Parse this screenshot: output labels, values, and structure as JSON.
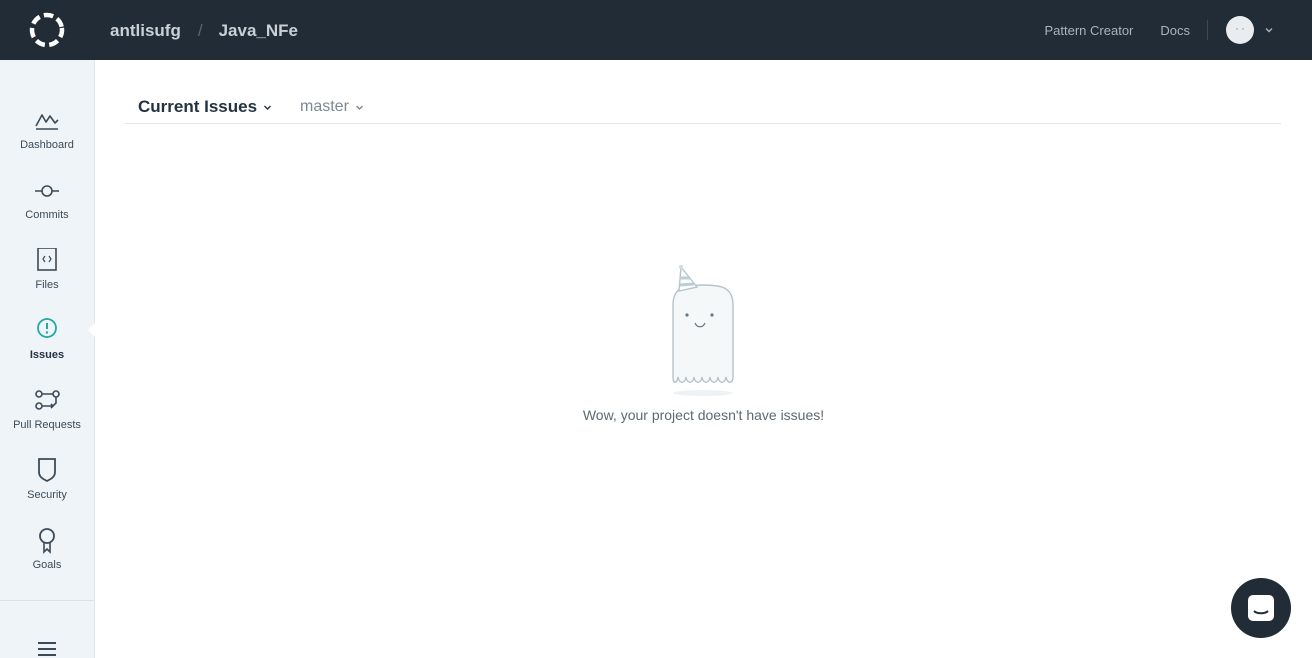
{
  "header": {
    "org": "antlisufg",
    "separator": "/",
    "repo": "Java_NFe",
    "links": {
      "pattern_creator": "Pattern Creator",
      "docs": "Docs"
    }
  },
  "sidebar": {
    "items": [
      {
        "label": "Dashboard",
        "icon": "dashboard-icon"
      },
      {
        "label": "Commits",
        "icon": "commit-icon"
      },
      {
        "label": "Files",
        "icon": "file-code-icon"
      },
      {
        "label": "Issues",
        "icon": "issue-icon",
        "active": true
      },
      {
        "label": "Pull Requests",
        "icon": "pull-request-icon"
      },
      {
        "label": "Security",
        "icon": "shield-icon"
      },
      {
        "label": "Goals",
        "icon": "goal-icon"
      }
    ]
  },
  "main": {
    "tab_label": "Current Issues",
    "branch": "master",
    "empty_message": "Wow, your project doesn't have issues!"
  },
  "colors": {
    "topbar": "#222c37",
    "sidebar": "#eef4f8",
    "accent": "#23a9a0"
  }
}
